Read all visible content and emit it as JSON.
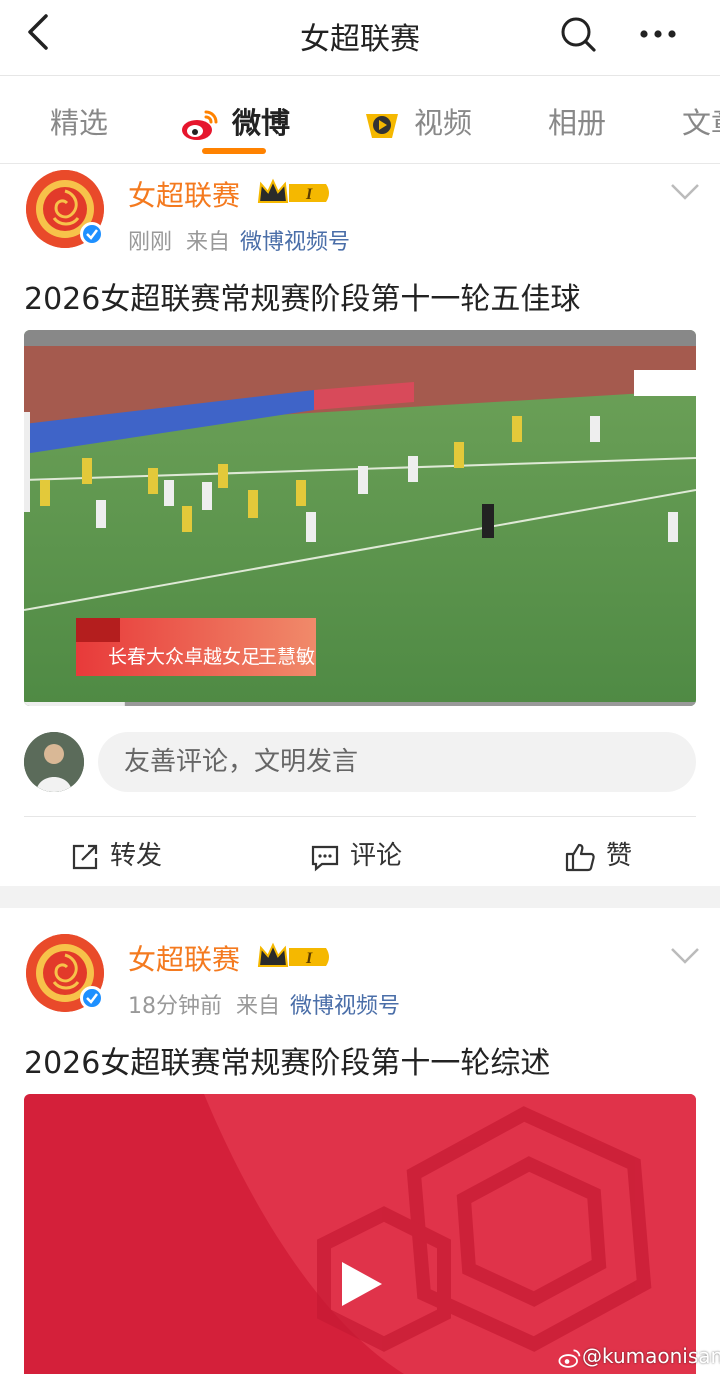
{
  "header": {
    "title": "女超联赛",
    "back_icon": "back-chevron-icon",
    "search_icon": "search-icon",
    "more_icon": "more-dots-icon"
  },
  "tabs": [
    {
      "label": "精选",
      "active": false
    },
    {
      "label": "微博",
      "active": true,
      "icon": "weibo-logo-icon"
    },
    {
      "label": "视频",
      "active": false,
      "icon": "video-play-icon"
    },
    {
      "label": "相册",
      "active": false
    },
    {
      "label": "文章",
      "active": false
    }
  ],
  "colors": {
    "accent": "#ff8200",
    "username": "#f47a1f",
    "source_link": "#4a6ea8",
    "verified": "#1e90ff"
  },
  "posts": [
    {
      "username": "女超联赛",
      "level_badge": "I",
      "time": "刚刚",
      "from_label": "来自",
      "source": "微博视频号",
      "text": "2026女超联赛常规赛阶段第十一轮五佳球",
      "video_caption_team": "长春大众卓越女足",
      "video_caption_player": "王慧敏",
      "video_progress": 0.15
    },
    {
      "username": "女超联赛",
      "level_badge": "I",
      "time": "18分钟前",
      "from_label": "来自",
      "source": "微博视频号",
      "text": "2026女超联赛常规赛阶段第十一轮综述"
    }
  ],
  "comment": {
    "placeholder": "友善评论，文明发言"
  },
  "actions": {
    "repost": "转发",
    "comment": "评论",
    "like": "赞"
  },
  "watermark": "@kumaonisan"
}
